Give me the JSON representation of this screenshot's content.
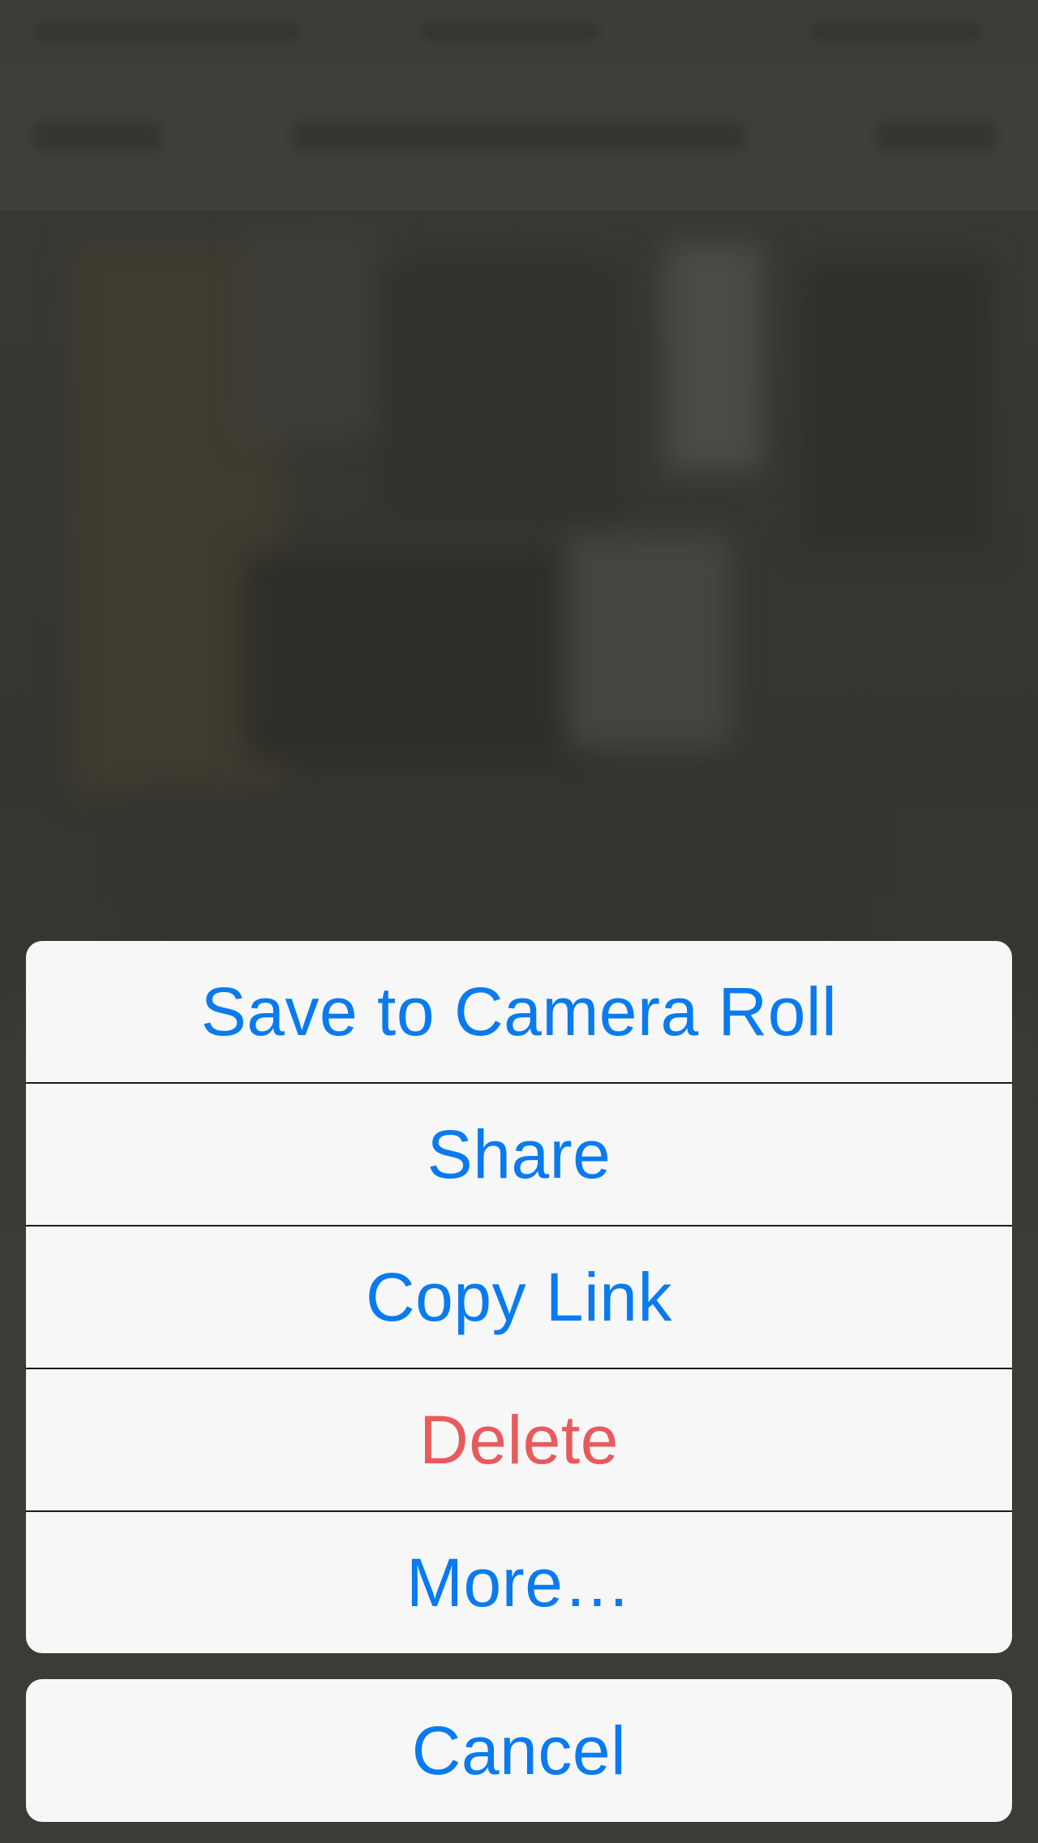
{
  "action_sheet": {
    "items": [
      {
        "id": "save",
        "label": "Save to Camera Roll",
        "style": "default"
      },
      {
        "id": "share",
        "label": "Share",
        "style": "default"
      },
      {
        "id": "copy-link",
        "label": "Copy Link",
        "style": "default"
      },
      {
        "id": "delete",
        "label": "Delete",
        "style": "destructive"
      },
      {
        "id": "more",
        "label": "More…",
        "style": "default"
      }
    ],
    "cancel_label": "Cancel"
  },
  "colors": {
    "action_blue": "#0a7aef",
    "destructive_red": "#e85a5c",
    "sheet_background": "#f7f7f7",
    "dimmed_backdrop": "#3a3a36"
  }
}
